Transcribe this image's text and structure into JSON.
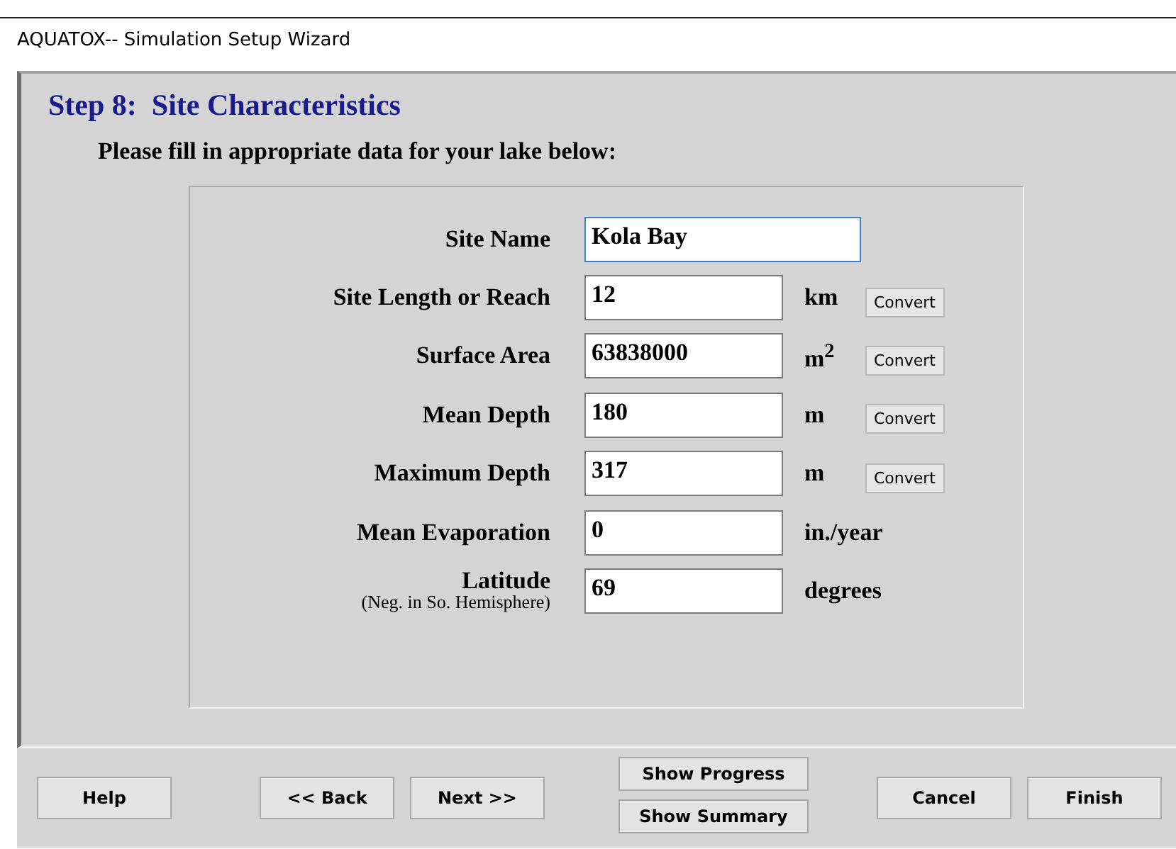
{
  "window": {
    "title": "AQUATOX-- Simulation Setup Wizard"
  },
  "step_title": "Step 8:  Site Characteristics",
  "instruction": "Please fill in appropriate data for your lake below:",
  "fields": [
    {
      "label": "Site Name",
      "value": "Kola Bay",
      "focused": true,
      "wide": true
    },
    {
      "label": "Site Length or Reach",
      "value": "12",
      "unit": "km",
      "convert": "Convert",
      "focused": false
    },
    {
      "label": "Surface Area",
      "value": "63838000",
      "unit": "m$^{2}$",
      "convert": "Convert",
      "focused": false
    },
    {
      "label": "Mean Depth",
      "value": "180",
      "unit": "m",
      "convert": "Convert",
      "focused": false
    },
    {
      "label": "Maximum Depth",
      "value": "317",
      "unit": "m",
      "convert": "Convert",
      "focused": false
    },
    {
      "label": "Mean Evaporation",
      "value": "0",
      "unit": "in./year",
      "focused": false
    },
    {
      "label": "Latitude",
      "sublabel": "(Neg. in So. Hemisphere)",
      "value": "69",
      "unit": "degrees",
      "focused": false
    }
  ],
  "buttons": {
    "help": "Help",
    "back": "<< Back",
    "next": "Next >>",
    "progress": "Show Progress",
    "summary": "Show Summary",
    "cancel": "Cancel",
    "finish": "Finish"
  }
}
